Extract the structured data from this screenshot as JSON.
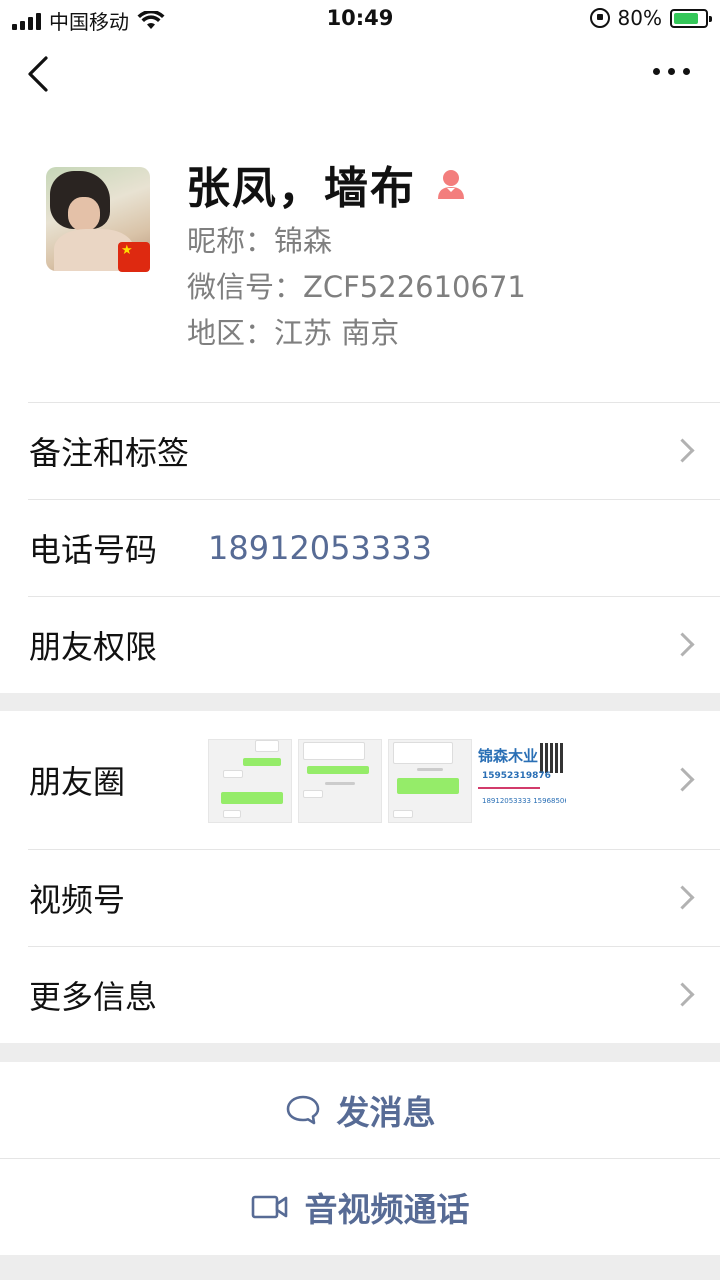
{
  "status_bar": {
    "carrier": "中国移动",
    "time": "10:49",
    "battery_percent": "80%",
    "battery_level": 0.8,
    "battery_color": "#34c759",
    "icons": [
      "signal-icon",
      "wifi-icon",
      "rotation-lock-icon",
      "battery-charging-icon"
    ]
  },
  "nav": {
    "back_icon": "chevron-left-icon",
    "more_icon": "more-dots-icon"
  },
  "profile": {
    "name": "张凤，墙布",
    "gender_icon": "female-icon",
    "gender_color": "#f37e7d",
    "nickname": "昵称：锦森",
    "wechat_id": "微信号：ZCF522610671",
    "region": "地区：江苏 南京",
    "flag_icon": "china-flag-icon"
  },
  "rows": {
    "remark_label": "备注和标签",
    "phone_label": "电话号码",
    "phone_value": "18912053333",
    "permissions_label": "朋友权限",
    "moments_label": "朋友圈",
    "channels_label": "视频号",
    "more_info_label": "更多信息"
  },
  "moments_thumbs": {
    "card_brand": "锦森木业",
    "card_phone": "15952319876",
    "card_footer": "18912053333 15968506960"
  },
  "actions": {
    "message_label": "发消息",
    "call_label": "音视频通话"
  },
  "colors": {
    "accent_link": "#576b95",
    "background": "#ededed"
  }
}
